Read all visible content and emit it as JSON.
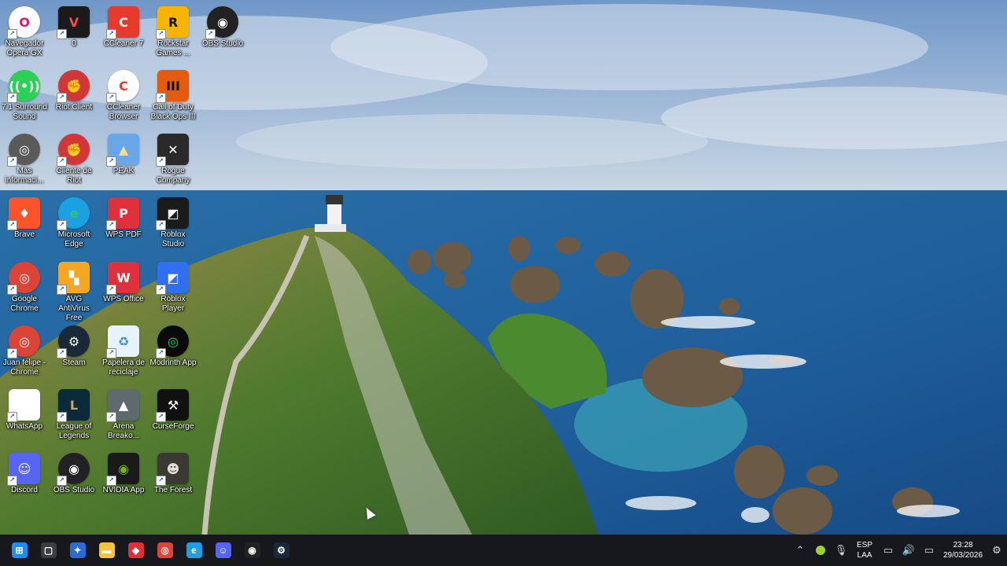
{
  "desktop_icons": [
    {
      "label": "Navegador Opera GX",
      "icon": "opera-gx-icon",
      "color": "#ffffff",
      "fg": "#e8135b",
      "glyph": "O",
      "round": true
    },
    {
      "label": "0",
      "icon": "valorant-icon",
      "color": "#1a1a1a",
      "fg": "#ff4655",
      "glyph": "V"
    },
    {
      "label": "CCleaner 7",
      "icon": "ccleaner-icon",
      "color": "#e53a2c",
      "fg": "#ffffff",
      "glyph": "C"
    },
    {
      "label": "Rockstar Games ...",
      "icon": "rockstar-icon",
      "color": "#f7b400",
      "fg": "#111111",
      "glyph": "R"
    },
    {
      "label": "OBS Studio",
      "icon": "obs-icon",
      "color": "#222222",
      "fg": "#ffffff",
      "glyph": "◉",
      "round": true
    },
    {
      "label": "7.1 Surround Sound",
      "icon": "surround-sound-icon",
      "color": "#2bd156",
      "fg": "#ffffff",
      "glyph": "((•))",
      "round": true
    },
    {
      "label": "Riot Client",
      "icon": "riot-client-icon",
      "color": "#d13639",
      "fg": "#ffffff",
      "glyph": "✊",
      "round": true
    },
    {
      "label": "CCleaner Browser",
      "icon": "ccleaner-browser-icon",
      "color": "#ffffff",
      "fg": "#e53a2c",
      "glyph": "C",
      "round": true
    },
    {
      "label": "Call of Duty Black Ops III",
      "icon": "black-ops-icon",
      "color": "#e65a0c",
      "fg": "#111111",
      "glyph": "III"
    },
    {
      "label": "Más informaci...",
      "icon": "info-icon",
      "color": "#5a5a5a",
      "fg": "#ffffff",
      "glyph": "◎",
      "round": true
    },
    {
      "label": "Cliente de Riot",
      "icon": "riot-client-icon",
      "color": "#d13639",
      "fg": "#ffffff",
      "glyph": "✊",
      "round": true
    },
    {
      "label": "PEAK",
      "icon": "peak-icon",
      "color": "#6aa6e8",
      "fg": "#f4e08a",
      "glyph": "▲"
    },
    {
      "label": "Rogue Company",
      "icon": "rogue-company-icon",
      "color": "#2a2a2a",
      "fg": "#ffffff",
      "glyph": "✕"
    },
    {
      "label": "Brave",
      "icon": "brave-icon",
      "color": "#fb542b",
      "fg": "#ffffff",
      "glyph": "♦"
    },
    {
      "label": "Microsoft Edge",
      "icon": "edge-icon",
      "color": "#1ba1e2",
      "fg": "#36c26b",
      "glyph": "e",
      "round": true
    },
    {
      "label": "WPS PDF",
      "icon": "wps-pdf-icon",
      "color": "#e0303b",
      "fg": "#ffffff",
      "glyph": "P"
    },
    {
      "label": "Roblox Studio",
      "icon": "roblox-studio-icon",
      "color": "#1b1b1b",
      "fg": "#ffffff",
      "glyph": "◩"
    },
    {
      "label": "Google Chrome",
      "icon": "chrome-icon",
      "color": "#db4437",
      "fg": "#ffffff",
      "glyph": "◎",
      "round": true
    },
    {
      "label": "AVG AntiVirus Free",
      "icon": "avg-icon",
      "color": "#f5a623",
      "fg": "#ffffff",
      "glyph": "▚"
    },
    {
      "label": "WPS Office",
      "icon": "wps-office-icon",
      "color": "#e0303b",
      "fg": "#ffffff",
      "glyph": "W"
    },
    {
      "label": "Roblox Player",
      "icon": "roblox-player-icon",
      "color": "#2f6ff0",
      "fg": "#ffffff",
      "glyph": "◩"
    },
    {
      "label": "Juan felipe - Chrome",
      "icon": "chrome-profile-icon",
      "color": "#db4437",
      "fg": "#ffffff",
      "glyph": "◎",
      "round": true
    },
    {
      "label": "Steam",
      "icon": "steam-icon",
      "color": "#1b2838",
      "fg": "#ffffff",
      "glyph": "⚙",
      "round": true
    },
    {
      "label": "Papelera de reciclaje",
      "icon": "recycle-bin-icon",
      "color": "#e8f2fb",
      "fg": "#3a8fd6",
      "glyph": "♻"
    },
    {
      "label": "Modrinth App",
      "icon": "modrinth-icon",
      "color": "#0a0a0a",
      "fg": "#1bd96a",
      "glyph": "◎",
      "round": true
    },
    {
      "label": "WhatsApp",
      "icon": "file-icon",
      "color": "#ffffff",
      "fg": "#cccccc",
      "glyph": " "
    },
    {
      "label": "League of Legends",
      "icon": "league-icon",
      "color": "#0b2a3a",
      "fg": "#c8aa6e",
      "glyph": "L"
    },
    {
      "label": "Arena Breako...",
      "icon": "arena-breakout-icon",
      "color": "#5e6a6e",
      "fg": "#ffffff",
      "glyph": "▲"
    },
    {
      "label": "CurseForge",
      "icon": "curseforge-icon",
      "color": "#111111",
      "fg": "#ffffff",
      "glyph": "⚒"
    },
    {
      "label": "Discord",
      "icon": "discord-icon",
      "color": "#5865f2",
      "fg": "#ffffff",
      "glyph": "☺"
    },
    {
      "label": "OBS Studio",
      "icon": "obs-icon",
      "color": "#222222",
      "fg": "#ffffff",
      "glyph": "◉",
      "round": true
    },
    {
      "label": "NVIDIA App",
      "icon": "nvidia-icon",
      "color": "#1a1a1a",
      "fg": "#76b900",
      "glyph": "◉"
    },
    {
      "label": "The Forest",
      "icon": "the-forest-icon",
      "color": "#3a3a32",
      "fg": "#ddd",
      "glyph": "☻"
    }
  ],
  "taskbar": {
    "apps": [
      {
        "name": "windows-start-icon",
        "color": "#1c8ef5",
        "glyph": "⊞"
      },
      {
        "name": "task-view-icon",
        "color": "#3a3d44",
        "glyph": "▢"
      },
      {
        "name": "copilot-icon",
        "color": "#2b6bd6",
        "glyph": "✦"
      },
      {
        "name": "file-explorer-icon",
        "color": "#f5c242",
        "glyph": "▬"
      },
      {
        "name": "app-red-diamond-icon",
        "color": "#e0303b",
        "glyph": "◆"
      },
      {
        "name": "chrome-icon",
        "color": "#db4437",
        "glyph": "◎"
      },
      {
        "name": "edge-icon",
        "color": "#1ba1e2",
        "glyph": "e"
      },
      {
        "name": "discord-icon",
        "color": "#5865f2",
        "glyph": "☺"
      },
      {
        "name": "obs-icon",
        "color": "#222222",
        "glyph": "◉"
      },
      {
        "name": "steam-icon",
        "color": "#1b2838",
        "glyph": "⚙"
      }
    ],
    "tray": {
      "language_line1": "ESP",
      "language_line2": "LAA",
      "time": "23:28",
      "date": "29/03/2026"
    }
  }
}
